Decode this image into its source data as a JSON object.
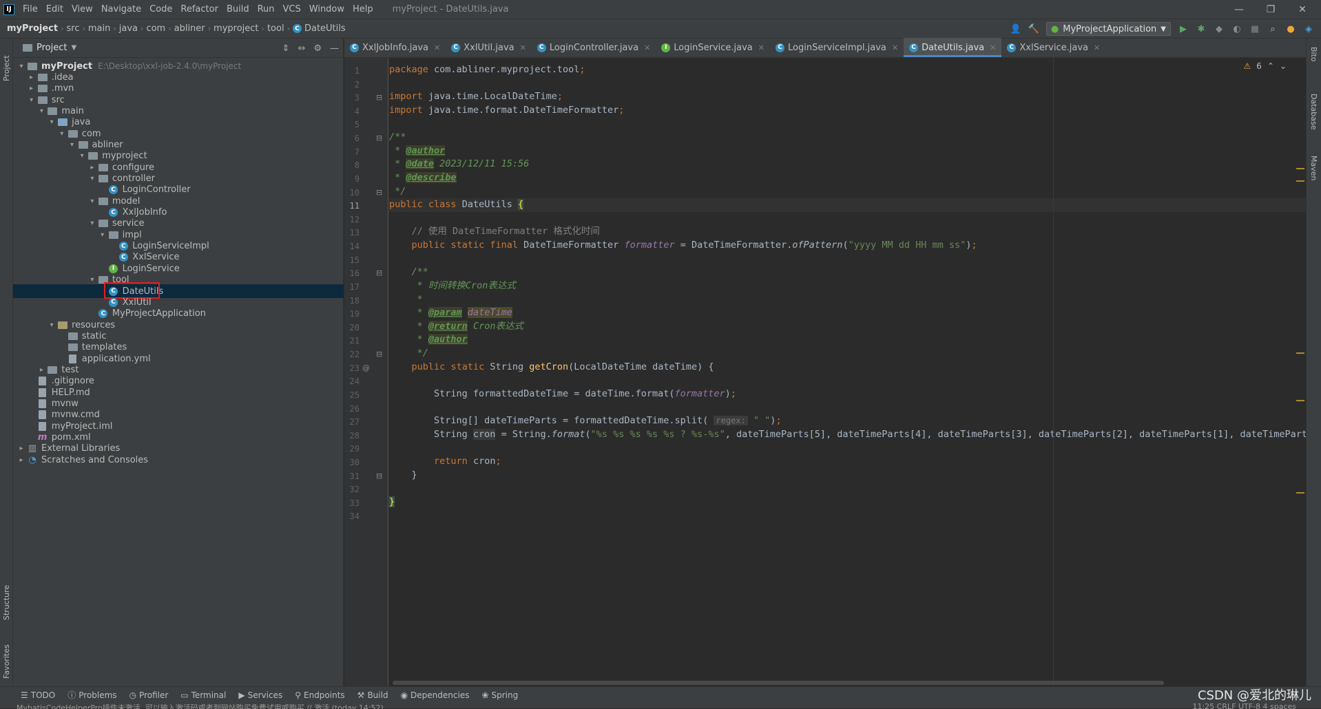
{
  "window": {
    "title": "myProject - DateUtils.java",
    "logo": "IJ",
    "menu": [
      "File",
      "Edit",
      "View",
      "Navigate",
      "Code",
      "Refactor",
      "Build",
      "Run",
      "VCS",
      "Window",
      "Help"
    ]
  },
  "breadcrumbs": [
    "myProject",
    "src",
    "main",
    "java",
    "com",
    "abliner",
    "myproject",
    "tool",
    "DateUtils"
  ],
  "toolbar": {
    "run_config": "MyProjectApplication"
  },
  "left_strip": {
    "project": "Project",
    "structure": "Structure",
    "favorites": "Favorites"
  },
  "right_strip": {
    "bito": "Bito",
    "database": "Database",
    "maven": "Maven"
  },
  "project_panel": {
    "title": "Project",
    "tree": [
      {
        "label": "myProject",
        "hint": "E:\\Desktop\\xxl-job-2.4.0\\myProject",
        "bold": true,
        "icon": "module"
      },
      {
        "label": ".idea",
        "icon": "folder"
      },
      {
        "label": ".mvn",
        "icon": "folder"
      },
      {
        "label": "src",
        "icon": "folder"
      },
      {
        "label": "main",
        "icon": "folder"
      },
      {
        "label": "java",
        "icon": "src"
      },
      {
        "label": "com",
        "icon": "folder"
      },
      {
        "label": "abliner",
        "icon": "folder"
      },
      {
        "label": "myproject",
        "icon": "folder"
      },
      {
        "label": "configure",
        "icon": "folder"
      },
      {
        "label": "controller",
        "icon": "folder"
      },
      {
        "label": "LoginController",
        "icon": "class"
      },
      {
        "label": "model",
        "icon": "folder"
      },
      {
        "label": "XxlJobInfo",
        "icon": "class"
      },
      {
        "label": "service",
        "icon": "folder"
      },
      {
        "label": "impl",
        "icon": "folder"
      },
      {
        "label": "LoginServiceImpl",
        "icon": "class"
      },
      {
        "label": "XxlService",
        "icon": "class"
      },
      {
        "label": "LoginService",
        "icon": "interface"
      },
      {
        "label": "tool",
        "icon": "folder"
      },
      {
        "label": "DateUtils",
        "icon": "class"
      },
      {
        "label": "XxlUtil",
        "icon": "class"
      },
      {
        "label": "MyProjectApplication",
        "icon": "class"
      },
      {
        "label": "resources",
        "icon": "resources"
      },
      {
        "label": "static",
        "icon": "folder"
      },
      {
        "label": "templates",
        "icon": "folder"
      },
      {
        "label": "application.yml",
        "icon": "file"
      },
      {
        "label": "test",
        "icon": "folder"
      },
      {
        "label": ".gitignore",
        "icon": "file"
      },
      {
        "label": "HELP.md",
        "icon": "file"
      },
      {
        "label": "mvnw",
        "icon": "file"
      },
      {
        "label": "mvnw.cmd",
        "icon": "file"
      },
      {
        "label": "myProject.iml",
        "icon": "file"
      },
      {
        "label": "pom.xml",
        "icon": "maven"
      },
      {
        "label": "External Libraries",
        "icon": "libs"
      },
      {
        "label": "Scratches and Consoles",
        "icon": "scratch"
      }
    ]
  },
  "tabs": [
    {
      "label": "XxlJobInfo.java",
      "icon": "class",
      "active": false
    },
    {
      "label": "XxlUtil.java",
      "icon": "class",
      "active": false
    },
    {
      "label": "LoginController.java",
      "icon": "class",
      "active": false
    },
    {
      "label": "LoginService.java",
      "icon": "interface",
      "active": false
    },
    {
      "label": "LoginServiceImpl.java",
      "icon": "class",
      "active": false
    },
    {
      "label": "DateUtils.java",
      "icon": "class",
      "active": true
    },
    {
      "label": "XxlService.java",
      "icon": "class",
      "active": false
    }
  ],
  "warnings": {
    "count": "6"
  },
  "code": {
    "current_line": 11,
    "lines": [
      "package com.abliner.myproject.tool;",
      "",
      "import java.time.LocalDateTime;",
      "import java.time.format.DateTimeFormatter;",
      "",
      "/**",
      " * @author",
      " * @date 2023/12/11 15:56",
      " * @describe",
      " */",
      "public class DateUtils {",
      "",
      "    // 使用 DateTimeFormatter 格式化时间",
      "    public static final DateTimeFormatter formatter = DateTimeFormatter.ofPattern(\"yyyy MM dd HH mm ss\");",
      "",
      "    /**",
      "     * 时间转换Cron表达式",
      "     *",
      "     * @param dateTime",
      "     * @return Cron表达式",
      "     * @author",
      "     */",
      "    public static String getCron(LocalDateTime dateTime) {",
      "",
      "        String formattedDateTime = dateTime.format(formatter);",
      "",
      "        String[] dateTimeParts = formattedDateTime.split( regex: \" \");",
      "        String cron = String.format(\"%s %s %s %s %s ? %s-%s\", dateTimeParts[5], dateTimeParts[4], dateTimeParts[3], dateTimeParts[2], dateTimeParts[1], dateTimeParts[",
      "",
      "        return cron;",
      "    }",
      "",
      "}",
      ""
    ]
  },
  "bottom_tools": [
    {
      "label": "TODO",
      "icon": "list-icon"
    },
    {
      "label": "Problems",
      "icon": "problems-icon"
    },
    {
      "label": "Profiler",
      "icon": "profiler-icon"
    },
    {
      "label": "Terminal",
      "icon": "terminal-icon"
    },
    {
      "label": "Services",
      "icon": "services-icon"
    },
    {
      "label": "Endpoints",
      "icon": "endpoints-icon"
    },
    {
      "label": "Build",
      "icon": "hammer-icon"
    },
    {
      "label": "Dependencies",
      "icon": "dependencies-icon"
    },
    {
      "label": "Spring",
      "icon": "spring-icon"
    }
  ],
  "status": {
    "message": "MybatisCodeHelperPro插件未激活, 可以输入激活码或者到网站购买免费试用或购买 // 激活 (today 14:52)",
    "position": "11:25  CRLF  UTF-8  4 spaces",
    "watermark": "CSDN @爱北的琳儿"
  }
}
